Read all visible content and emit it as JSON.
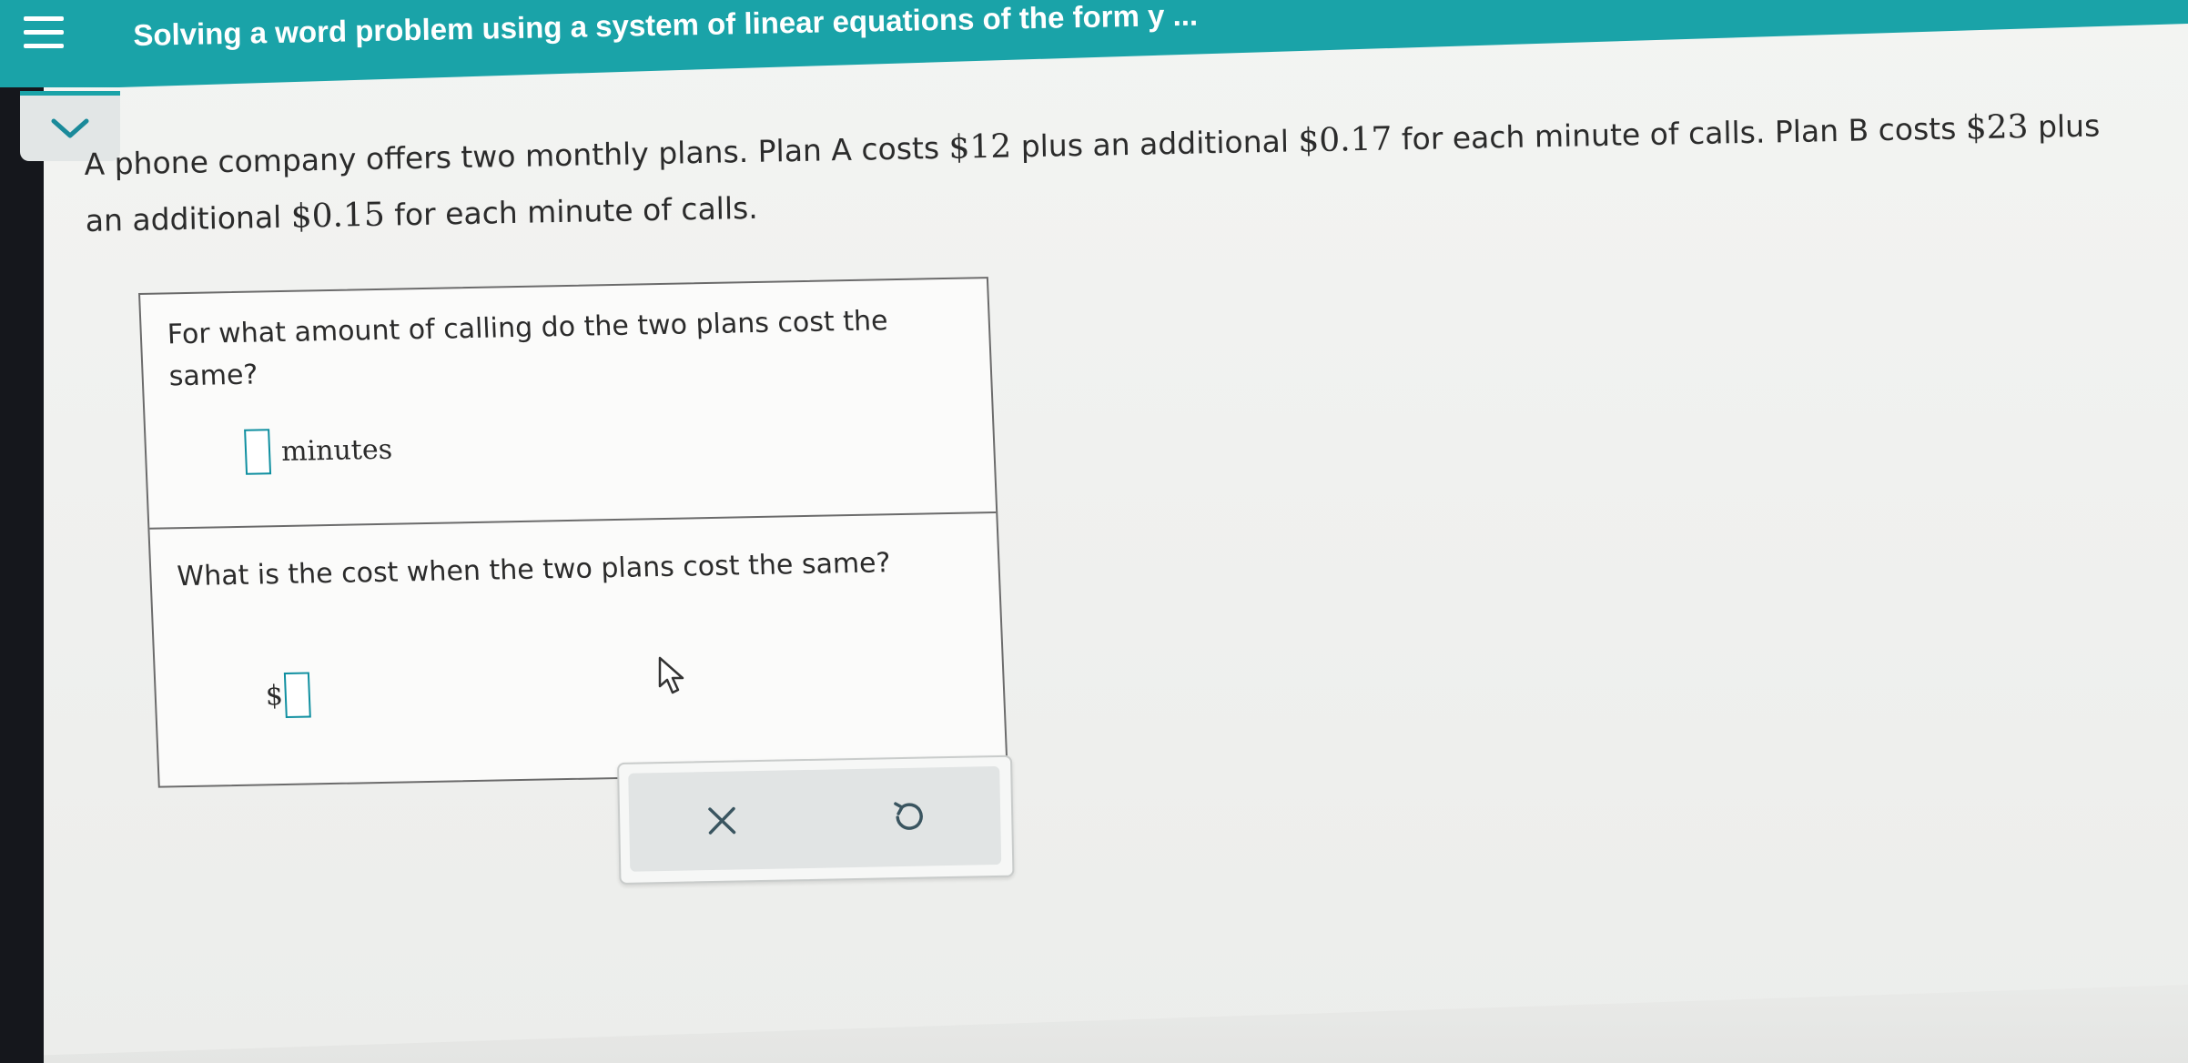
{
  "header": {
    "title": "Solving a word problem using a system of linear equations of the form y ...",
    "menu_icon": "hamburger-menu-icon",
    "accent_color": "#1aa3a8"
  },
  "collapse": {
    "icon": "chevron-down-icon"
  },
  "problem": {
    "line1_part1": "A phone company offers two monthly plans. Plan A costs ",
    "plan_a_base": "$12",
    "line1_part2": " plus an additional ",
    "plan_a_rate": "$0.17",
    "line1_part3": " for each minute of calls. Plan B costs ",
    "plan_b_base": "$23",
    "line1_part4": " plus an additional ",
    "plan_b_rate": "$0.15",
    "line1_part5": " for each minute of calls."
  },
  "questions": {
    "q1": {
      "text": "For what amount of calling do the two plans cost the same?",
      "unit": "minutes",
      "value": ""
    },
    "q2": {
      "text": "What is the cost when the two plans cost the same?",
      "prefix": "$",
      "value": ""
    }
  },
  "actions": {
    "clear_icon": "close-icon",
    "undo_icon": "undo-icon"
  }
}
